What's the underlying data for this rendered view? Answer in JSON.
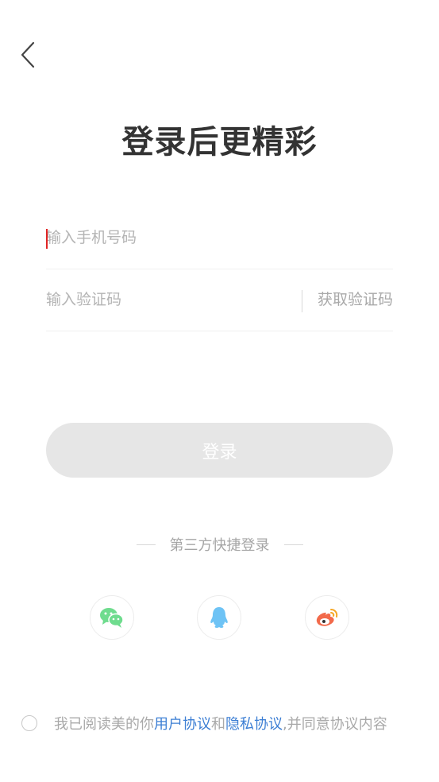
{
  "header": {
    "title": "登录后更精彩"
  },
  "form": {
    "phone_placeholder": "输入手机号码",
    "phone_value": "",
    "code_placeholder": "输入验证码",
    "code_value": "",
    "get_code_label": "获取验证码",
    "login_label": "登录"
  },
  "third_party": {
    "label": "第三方快捷登录",
    "providers": [
      {
        "name": "wechat-icon",
        "color": "#6fdc8e"
      },
      {
        "name": "qq-icon",
        "color": "#6ec3f5"
      },
      {
        "name": "weibo-icon",
        "color": "#f26a4b"
      }
    ]
  },
  "agreement": {
    "prefix": "我已阅读美的你",
    "user_agreement": "用户协议",
    "connector": " 和",
    "privacy_agreement": "隐私协议",
    "suffix": ",并同意协议内容"
  },
  "colors": {
    "link": "#3d7fd4",
    "caret": "#e02424",
    "button_disabled": "#e6e6e6"
  }
}
